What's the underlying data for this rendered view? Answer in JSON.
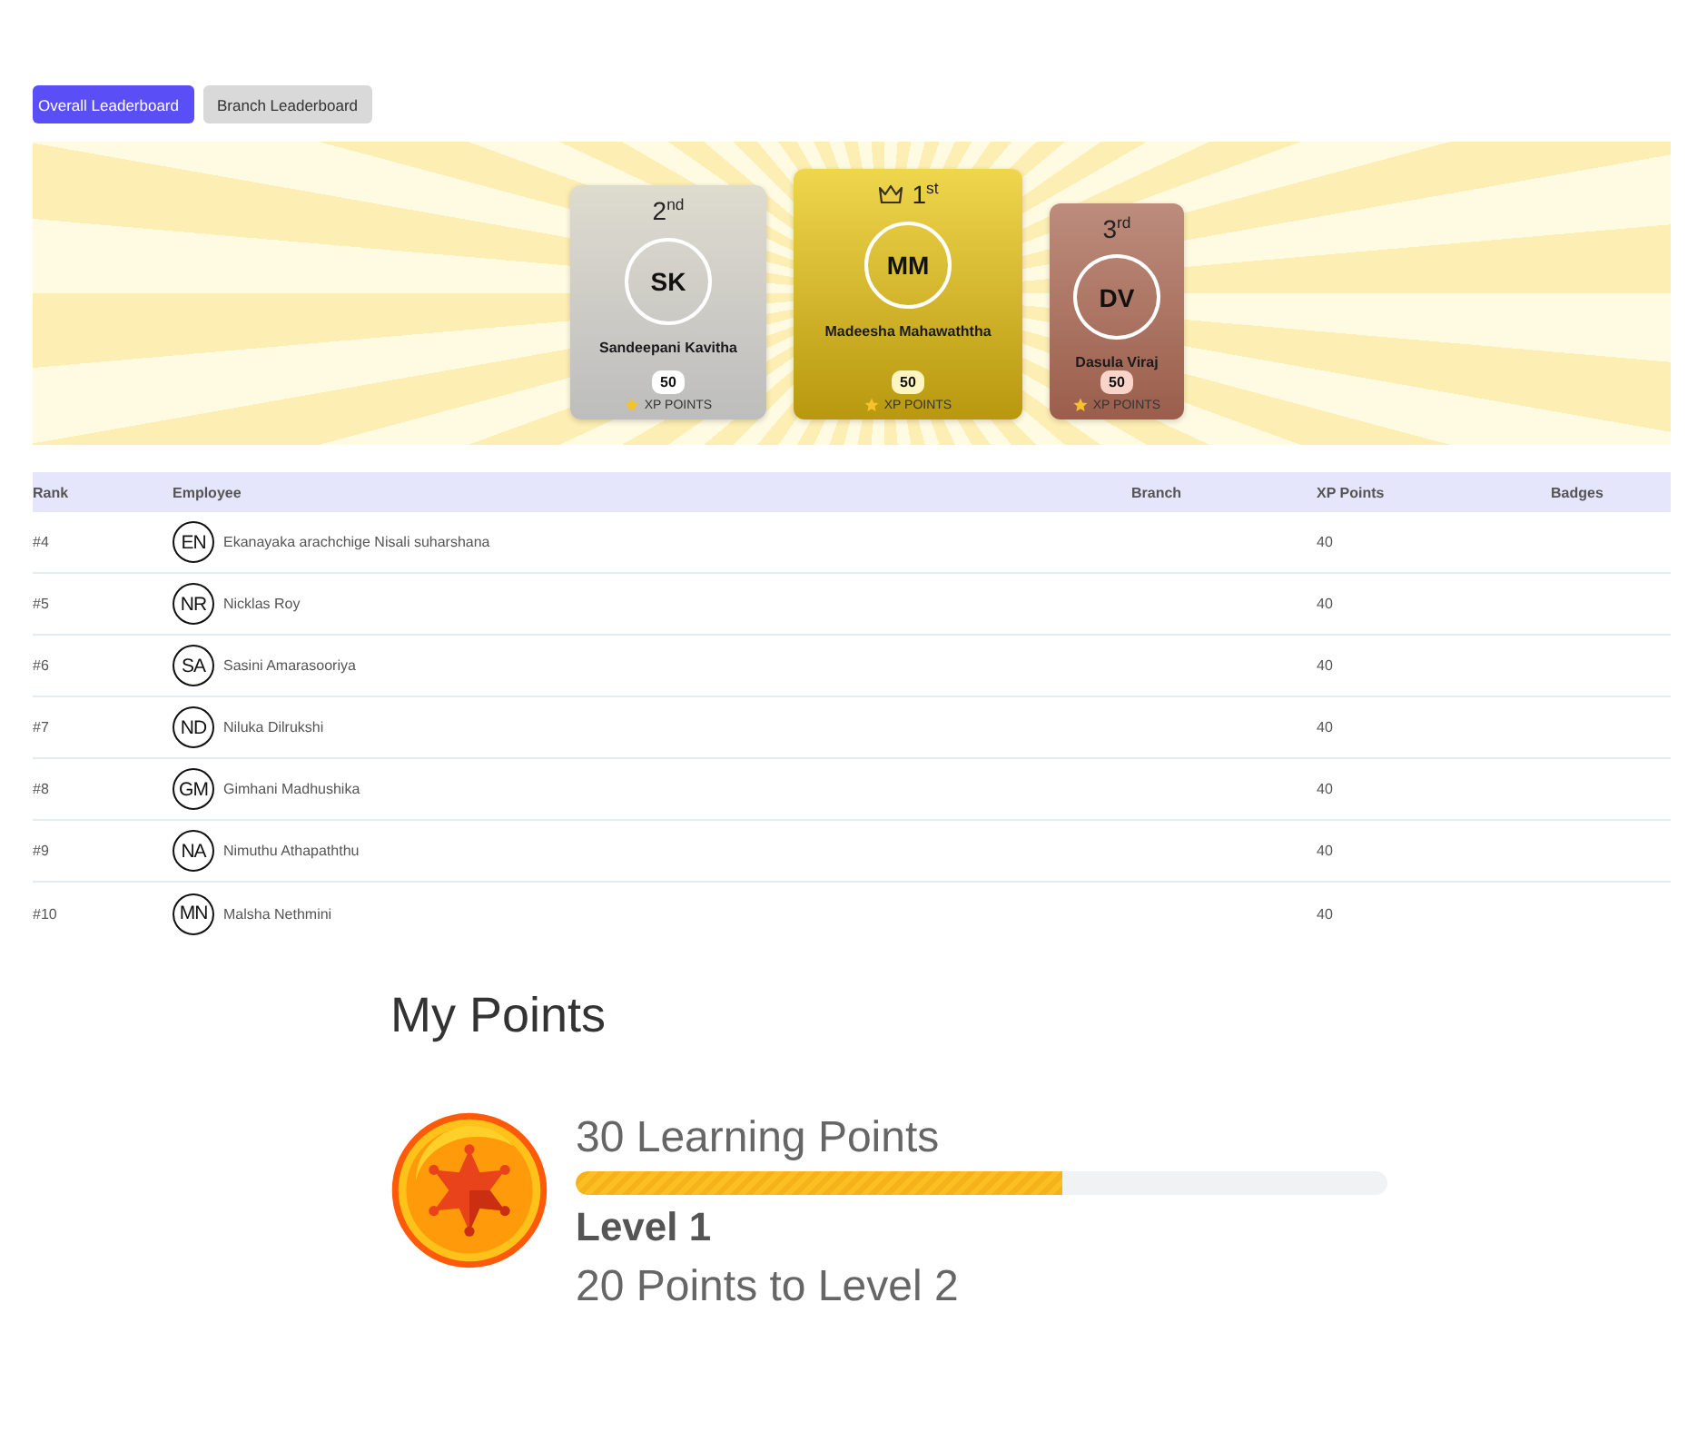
{
  "tabs": [
    {
      "label": "Overall Leaderboard",
      "selected": true
    },
    {
      "label": "Branch Leaderboard",
      "selected": false
    }
  ],
  "podium": [
    {
      "kind": "silver",
      "place": "2$^{nd}$",
      "crown": false,
      "initials": "SK",
      "name": "Sandeepani Kavitha",
      "points": "50",
      "points_label": "XP POINTS"
    },
    {
      "kind": "gold",
      "place": "1$^{st}$",
      "crown": true,
      "initials": "MM",
      "name": "Madeesha Mahawaththa",
      "points": "50",
      "points_label": "XP POINTS"
    },
    {
      "kind": "bronze",
      "place": "3$^{rd}$",
      "crown": false,
      "initials": "DV",
      "name": "Dasula Viraj",
      "points": "50",
      "points_label": "XP POINTS"
    }
  ],
  "table": {
    "columns": [
      "Rank",
      "Employee",
      "Branch",
      "XP Points",
      "Badges"
    ],
    "rows": [
      {
        "rank": "#4",
        "initials": "EN",
        "name": "Ekanayaka arachchige Nisali suharshana",
        "xp_points": "40"
      },
      {
        "rank": "#5",
        "initials": "NR",
        "name": "Nicklas Roy",
        "xp_points": "40"
      },
      {
        "rank": "#6",
        "initials": "SA",
        "name": "Sasini Amarasooriya",
        "xp_points": "40"
      },
      {
        "rank": "#7",
        "initials": "ND",
        "name": "Niluka Dilrukshi",
        "xp_points": "40"
      },
      {
        "rank": "#8",
        "initials": "GM",
        "name": "Gimhani Madhushika",
        "xp_points": "40"
      },
      {
        "rank": "#9",
        "initials": "NA",
        "name": "Nimuthu Athapaththu",
        "xp_points": "40"
      },
      {
        "rank": "#10",
        "initials": "MN",
        "name": "Malsha Nethmini",
        "xp_points": "40"
      }
    ]
  },
  "my_points": {
    "title": "My Points",
    "points": "30 Learning Points",
    "level": 0.6,
    "level_name": "Level 1",
    "to_next": "20 Points to Level 2"
  }
}
